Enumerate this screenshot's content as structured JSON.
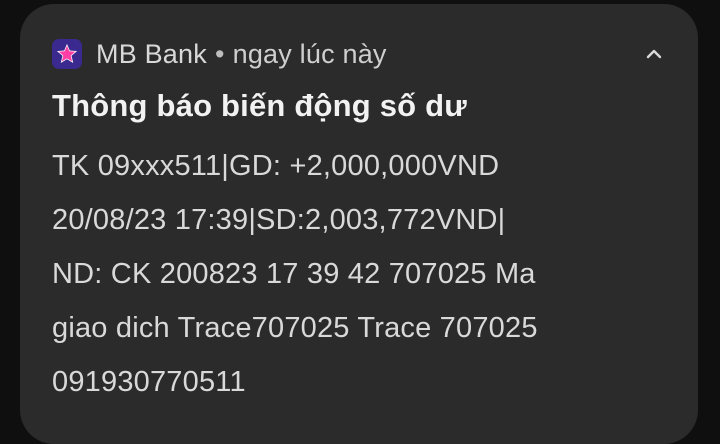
{
  "notification": {
    "app_name": "MB Bank",
    "separator": "•",
    "time": "ngay lúc này",
    "title": "Thông báo biến động số dư",
    "body_lines": [
      "TK 09xxx511|GD: +2,000,000VND",
      "20/08/23 17:39|SD:2,003,772VND|",
      "ND: CK 200823 17 39 42 707025 Ma",
      "giao dich Trace707025 Trace 707025",
      "091930770511"
    ]
  },
  "icons": {
    "app_icon": "mb-bank-star-icon",
    "chevron": "chevron-up-icon"
  },
  "colors": {
    "background": "#0f0f0f",
    "card": "#2b2b2b",
    "app_icon_bg": "#3a2a8f",
    "app_icon_star": "#ff3ea5"
  }
}
